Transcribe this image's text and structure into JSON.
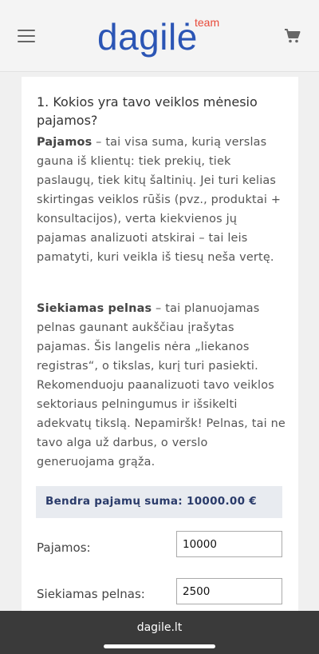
{
  "header": {
    "logo_text": "dagilė",
    "logo_badge": "team",
    "menu_icon": "hamburger-menu-icon",
    "cart_icon": "shopping-cart-icon"
  },
  "content": {
    "question_title": "1. Kokios yra tavo veiklos mėnesio pajamos?",
    "p1_term": "Pajamos",
    "p1_text": " – tai visa suma, kurią verslas gauna iš klientų: tiek prekių, tiek paslaugų, tiek kitų šaltinių. Jei turi kelias skirtingas veiklos rūšis (pvz., produktai + konsultacijos), verta kiekvienos jų pajamas analizuoti atskirai – tai leis pamatyti, kuri veikla iš tiesų neša vertę.",
    "p2_term": "Siekiamas pelnas",
    "p2_text": " – tai planuojamas pelnas gaunant aukščiau įrašytas pajamas. Šis langelis nėra „liekanos registras“, o tikslas, kurį turi pasiekti. Rekomenduoju paanalizuoti tavo veiklos sektoriaus pelningumus ir išsikelti adekvatų tikslą. Nepamiršk! Pelnas, tai ne tavo alga už darbus, o verslo generuojama grąža.",
    "summary": "Bendra pajamų suma: 10000.00 €",
    "income_label": "Pajamos:",
    "income_value": "10000",
    "profit_label": "Siekiamas pelnas:",
    "profit_value": "2500"
  },
  "browser": {
    "url": "dagile.lt"
  },
  "colors": {
    "brand_blue": "#2b55b5",
    "brand_red": "#e84a3a",
    "summary_bg": "#e8ebf0"
  }
}
